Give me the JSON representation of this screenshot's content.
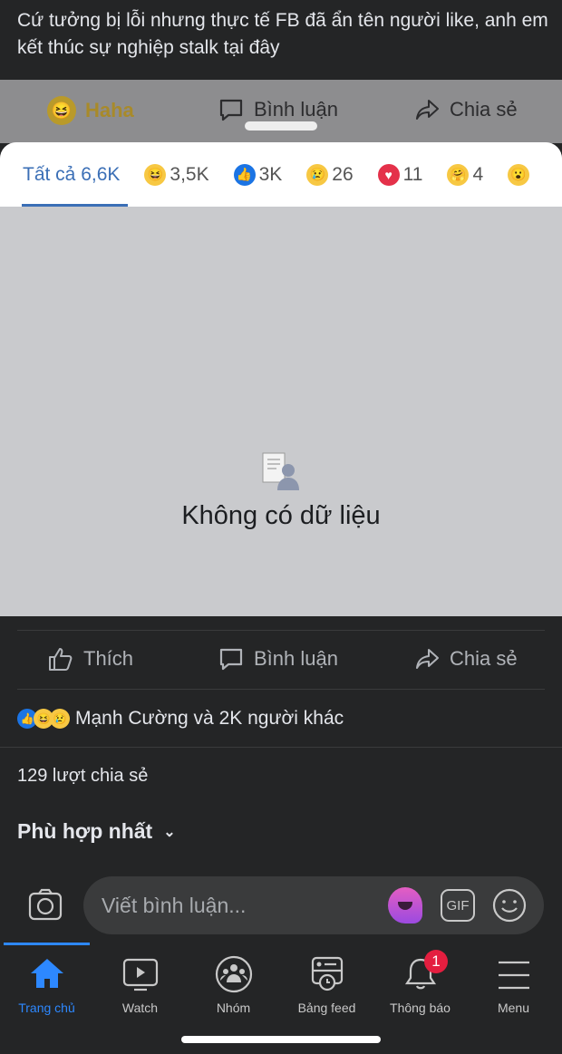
{
  "post": {
    "caption": "Cứ tưởng bị lỗi nhưng thực tế FB đã ẩn tên người like, anh em kết thúc sự nghiệp stalk tại đây"
  },
  "dim_actions": {
    "reaction": "Haha",
    "comment": "Bình luận",
    "share": "Chia sẻ"
  },
  "reactions_modal": {
    "tabs": [
      {
        "label": "Tất cả 6,6K",
        "active": true
      },
      {
        "icon": "haha-icon",
        "count": "3,5K"
      },
      {
        "icon": "like-icon",
        "count": "3K"
      },
      {
        "icon": "sad-icon",
        "count": "26"
      },
      {
        "icon": "love-icon",
        "count": "11"
      },
      {
        "icon": "care-icon",
        "count": "4"
      },
      {
        "icon": "wow-icon",
        "count": ""
      }
    ],
    "empty_text": "Không có dữ liệu",
    "accent": "#3b6fb6"
  },
  "actions": {
    "like": "Thích",
    "comment": "Bình luận",
    "share": "Chia sẻ"
  },
  "reaction_summary": "Mạnh Cường và 2K người khác",
  "shares": "129 lượt chia sẻ",
  "sort": "Phù hợp nhất",
  "composer": {
    "placeholder": "Viết bình luận...",
    "gif": "GIF"
  },
  "nav": [
    {
      "label": "Trang chủ",
      "active": true
    },
    {
      "label": "Watch"
    },
    {
      "label": "Nhóm"
    },
    {
      "label": "Bảng feed"
    },
    {
      "label": "Thông báo",
      "badge": "1"
    },
    {
      "label": "Menu"
    }
  ]
}
